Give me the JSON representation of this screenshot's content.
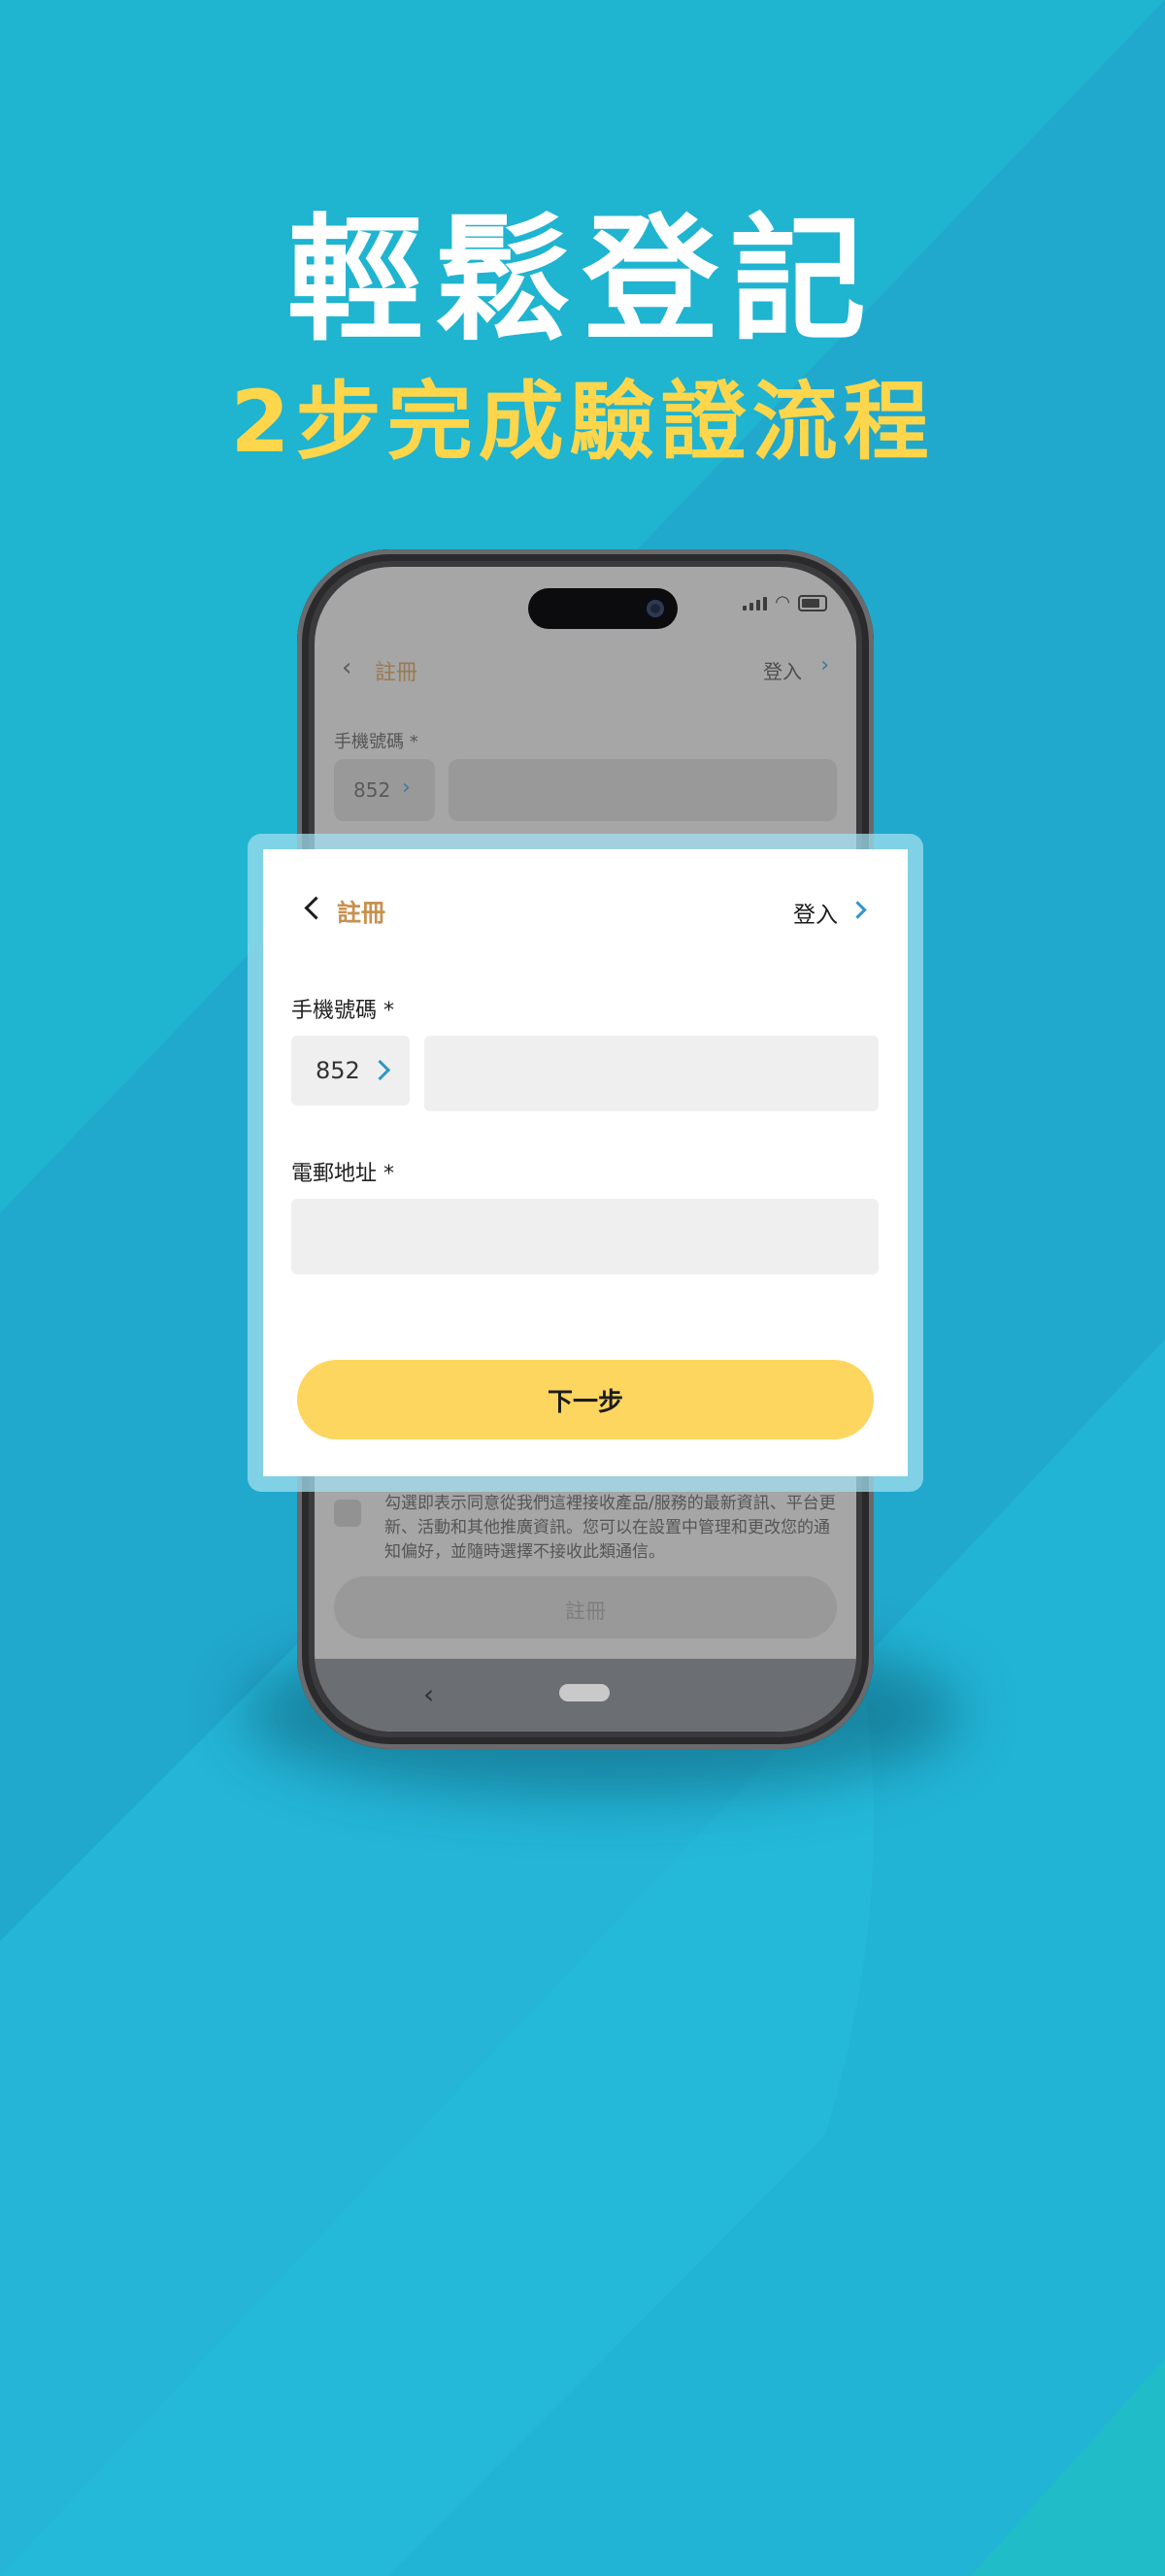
{
  "headline": {
    "title": "輕鬆登記",
    "subtitle": "2步完成驗證流程"
  },
  "colors": {
    "background": "#1fa9cf",
    "title": "#ffffff",
    "subtitle": "#fdd64b",
    "accent_gold": "#c8914f",
    "button_yellow": "#fdd65f",
    "chevron_blue": "#2f97c7"
  },
  "background_screen": {
    "nav_title": "註冊",
    "login_label": "登入",
    "phone_label": "手機號碼 *",
    "country_code": "852",
    "consent_text": "勾選即表示同意從我們這裡接收產品/服務的最新資訊、平台更新、活動和其他推廣資訊。您可以在設置中管理和更改您的通知偏好，並隨時選擇不接收此類通信。",
    "register_button": "註冊"
  },
  "form": {
    "title": "註冊",
    "login_label": "登入",
    "phone": {
      "label": "手機號碼 *",
      "country_code": "852",
      "value": ""
    },
    "email": {
      "label": "電郵地址 *",
      "value": ""
    },
    "next_button": "下一步"
  },
  "icons": {
    "back": "chevron-left-icon",
    "login_chevron": "chevron-right-icon",
    "code_chevron": "chevron-right-icon"
  }
}
